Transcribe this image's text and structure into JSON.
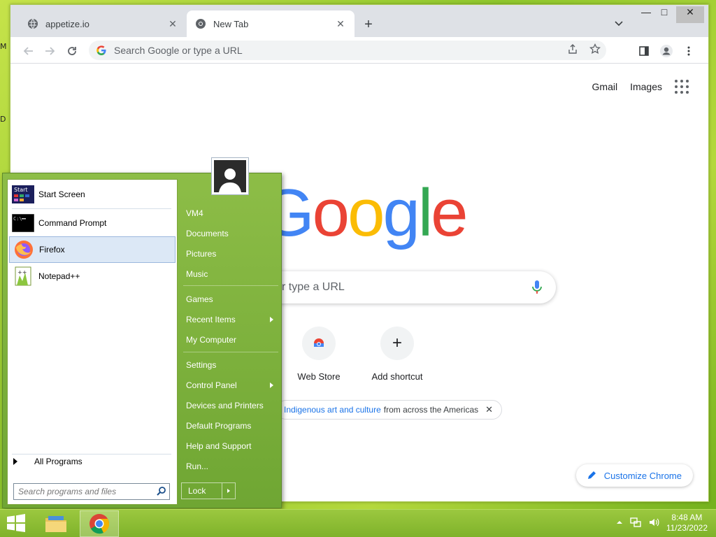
{
  "desktop": {
    "fragments": [
      "M",
      "D"
    ]
  },
  "browser": {
    "tabs": [
      {
        "label": "appetize.io",
        "icon": "globe-icon",
        "close": "✕"
      },
      {
        "label": "New Tab",
        "icon": "chrome-icon",
        "close": "✕"
      }
    ],
    "new_tab": "+",
    "window_controls": {
      "minimize": "—",
      "maximize": "□",
      "close": "✕"
    },
    "omnibox": {
      "placeholder": "Search Google or type a URL"
    },
    "page": {
      "top_links": [
        "Gmail",
        "Images"
      ],
      "logo_letters": [
        {
          "ch": "G",
          "color": "#4285f4"
        },
        {
          "ch": "o",
          "color": "#ea4335"
        },
        {
          "ch": "o",
          "color": "#fbbc05"
        },
        {
          "ch": "g",
          "color": "#4285f4"
        },
        {
          "ch": "l",
          "color": "#34a853"
        },
        {
          "ch": "e",
          "color": "#ea4335"
        }
      ],
      "search_visible_text": "r type a URL",
      "shortcuts": [
        {
          "label": "Web Store",
          "icon": "chrome-webstore-icon"
        },
        {
          "label": "Add shortcut",
          "icon": "plus-icon",
          "symbol": "+"
        }
      ],
      "promo": {
        "link": "Indigenous art and culture",
        "text": "from across the Americas",
        "close": "✕"
      },
      "customize": "Customize Chrome"
    }
  },
  "start_menu": {
    "programs": [
      {
        "label": "Start Screen",
        "icon": "start-screen-icon"
      },
      {
        "label": "Command Prompt",
        "icon": "cmd-icon"
      },
      {
        "label": "Firefox",
        "icon": "firefox-icon"
      },
      {
        "label": "Notepad++",
        "icon": "notepadpp-icon"
      }
    ],
    "all_programs": "All Programs",
    "search_placeholder": "Search programs and files",
    "right_items": [
      {
        "label": "VM4"
      },
      {
        "label": "Documents"
      },
      {
        "label": "Pictures"
      },
      {
        "label": "Music"
      },
      {
        "label": "Games"
      },
      {
        "label": "Recent Items",
        "submenu": true
      },
      {
        "label": "My Computer"
      },
      {
        "label": "Settings"
      },
      {
        "label": "Control Panel",
        "submenu": true
      },
      {
        "label": "Devices and Printers"
      },
      {
        "label": "Default Programs"
      },
      {
        "label": "Help and Support"
      },
      {
        "label": "Run..."
      }
    ],
    "lock": "Lock"
  },
  "taskbar": {
    "clock": {
      "time": "8:48 AM",
      "date": "11/23/2022"
    }
  }
}
